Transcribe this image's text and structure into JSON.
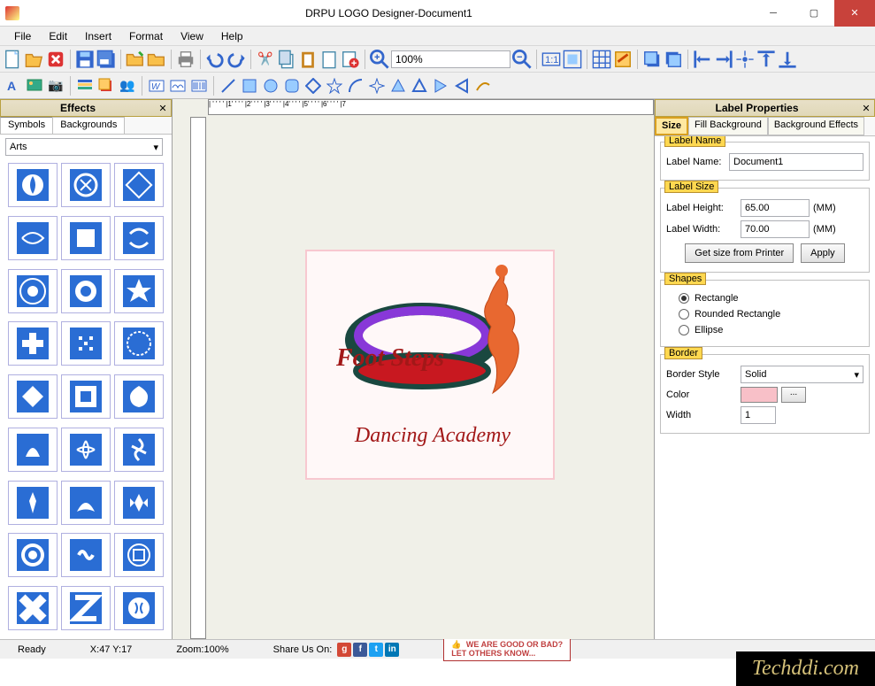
{
  "titlebar": {
    "text": "DRPU LOGO Designer-Document1"
  },
  "menu": {
    "file": "File",
    "edit": "Edit",
    "insert": "Insert",
    "format": "Format",
    "view": "View",
    "help": "Help"
  },
  "toolbar": {
    "zoom_value": "100%"
  },
  "effects": {
    "title": "Effects",
    "tab_symbols": "Symbols",
    "tab_backgrounds": "Backgrounds",
    "category": "Arts"
  },
  "canvas": {
    "logo_line1": "Foot Steps",
    "logo_line2": "Dancing Academy"
  },
  "props": {
    "title": "Label Properties",
    "tab_size": "Size",
    "tab_fill": "Fill Background",
    "tab_effects": "Background Effects",
    "labelname_section": "Label Name",
    "labelname_label": "Label Name:",
    "labelname_value": "Document1",
    "labelsize_section": "Label Size",
    "height_label": "Label Height:",
    "height_value": "65.00",
    "width_label": "Label Width:",
    "width_value": "70.00",
    "unit": "(MM)",
    "get_printer": "Get size from Printer",
    "apply": "Apply",
    "shapes_section": "Shapes",
    "shape_rect": "Rectangle",
    "shape_rrect": "Rounded Rectangle",
    "shape_ellipse": "Ellipse",
    "border_section": "Border",
    "border_style_label": "Border Style",
    "border_style_value": "Solid",
    "color_label": "Color",
    "color_btn": "...",
    "width_border_label": "Width",
    "width_border_value": "1"
  },
  "status": {
    "ready": "Ready",
    "coords": "X:47 Y:17",
    "zoom": "Zoom:100%",
    "share": "Share Us On:",
    "feedback1": "WE ARE GOOD OR BAD?",
    "feedback2": "LET OTHERS KNOW..."
  },
  "watermark": "Techddi.com"
}
